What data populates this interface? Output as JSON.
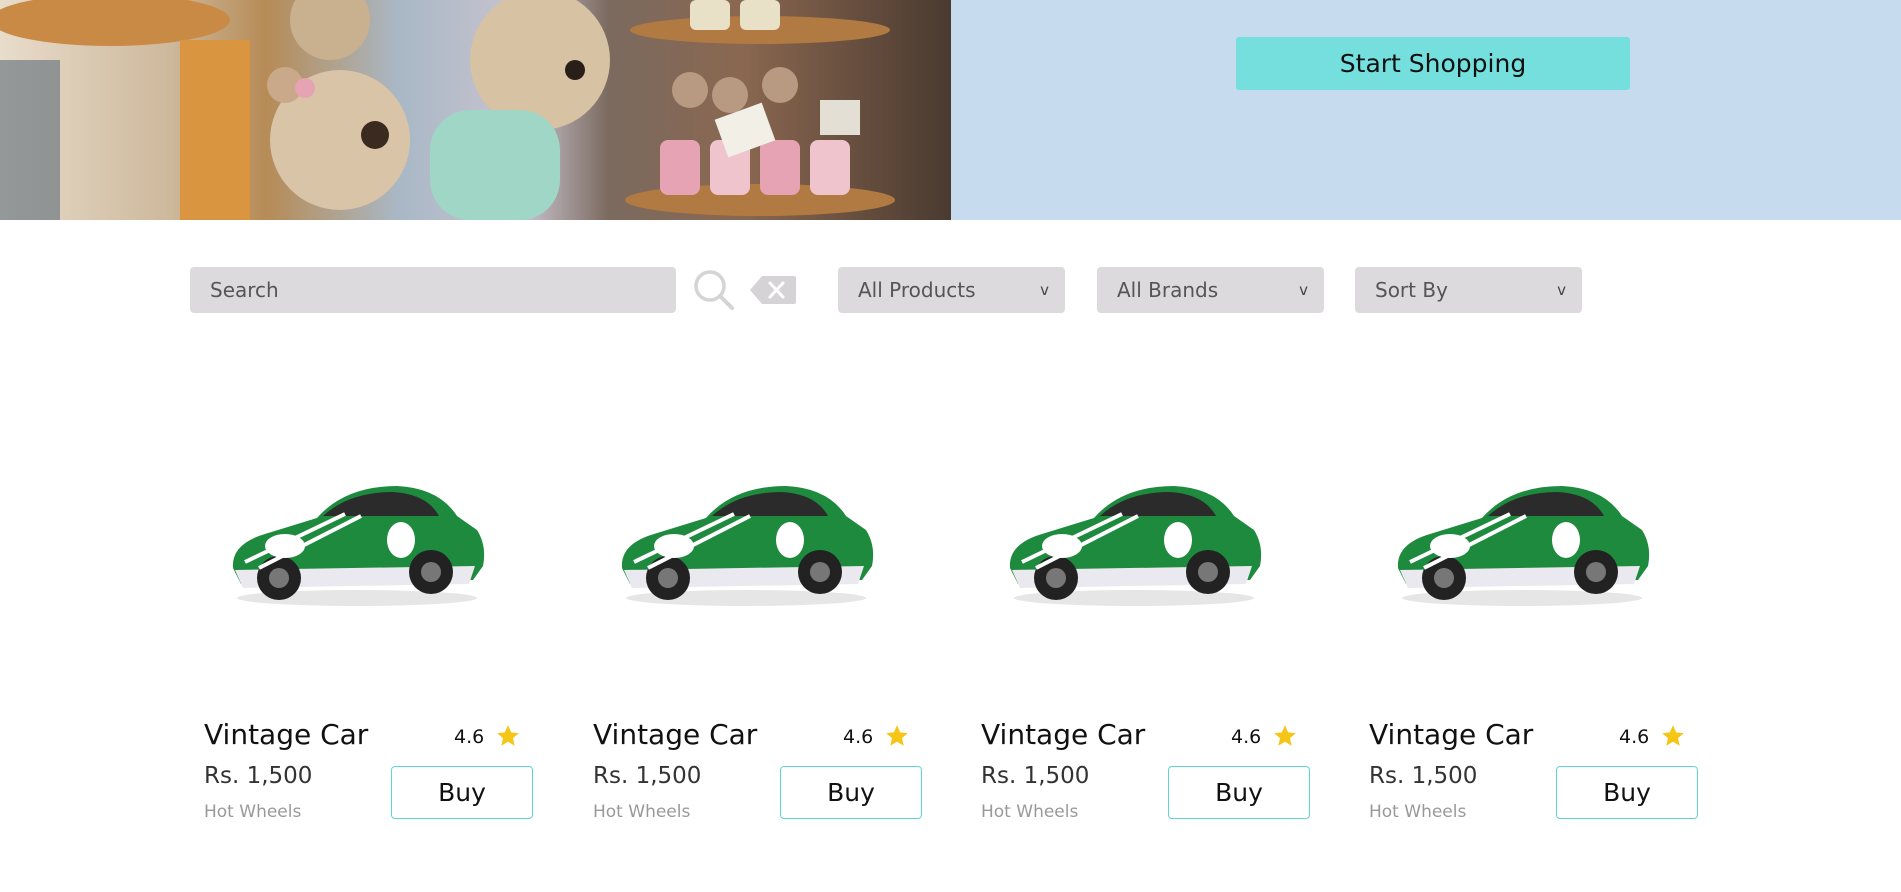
{
  "hero": {
    "cta_label": "Start Shopping"
  },
  "filters": {
    "search_placeholder": "Search",
    "category_selected": "All Products",
    "brand_selected": "All Brands",
    "sort_selected": "Sort By",
    "chevron": "v"
  },
  "products": [
    {
      "name": "Vintage Car",
      "price": "Rs. 1,500",
      "brand": "Hot Wheels",
      "rating": "4.6",
      "buy_label": "Buy"
    },
    {
      "name": "Vintage Car",
      "price": "Rs. 1,500",
      "brand": "Hot Wheels",
      "rating": "4.6",
      "buy_label": "Buy"
    },
    {
      "name": "Vintage Car",
      "price": "Rs. 1,500",
      "brand": "Hot Wheels",
      "rating": "4.6",
      "buy_label": "Buy"
    },
    {
      "name": "Vintage Car",
      "price": "Rs. 1,500",
      "brand": "Hot Wheels",
      "rating": "4.6",
      "buy_label": "Buy"
    }
  ],
  "colors": {
    "accent": "#74dfdc",
    "hero_panel": "#c7dbef",
    "input_bg": "#dcdadd",
    "star": "#f5c518",
    "car_green": "#1e8a3e"
  },
  "icons": {
    "search": "search-icon",
    "clear": "clear-icon",
    "star": "star-icon",
    "chevron": "chevron-down-icon"
  }
}
